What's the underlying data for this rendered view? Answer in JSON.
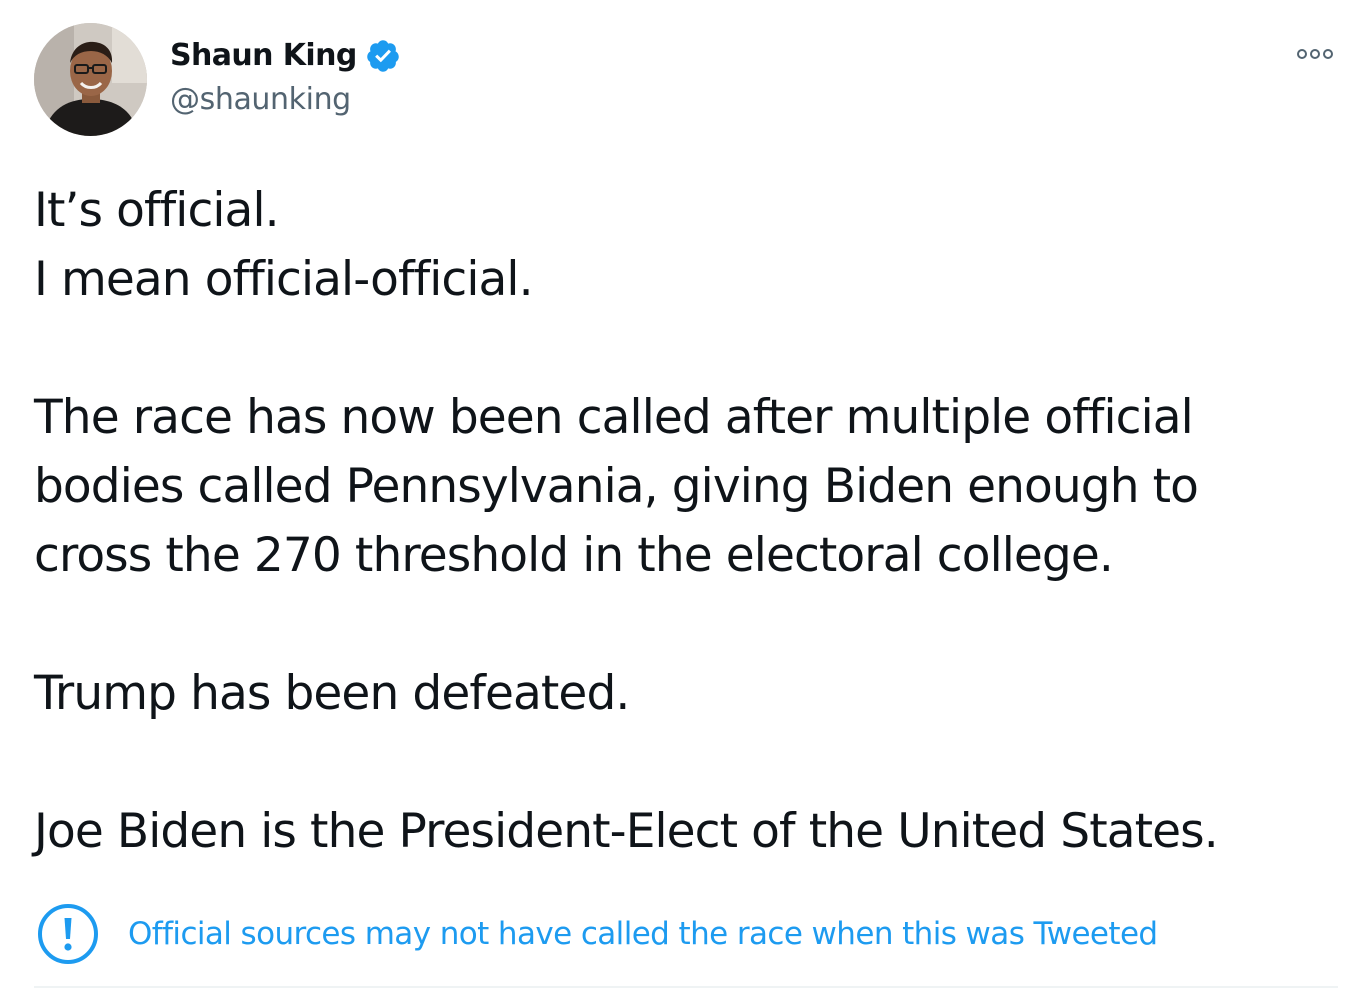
{
  "user": {
    "display_name": "Shaun King",
    "handle": "@shaunking",
    "verified_icon": "verified-badge-icon",
    "accent_color": "#1d9bf0"
  },
  "more_icon": "more-options-icon",
  "tweet": {
    "lines": [
      "It’s official.",
      "I mean official-official.",
      "",
      "The race has now been called after multiple official",
      "bodies called Pennsylvania, giving Biden enough to",
      "cross the 270 threshold in the electoral college.",
      "",
      "Trump has been defeated.",
      "",
      "Joe Biden is the President-Elect of the United States."
    ]
  },
  "notice": {
    "icon": "exclamation-circle-icon",
    "text": "Official sources may not have called the race when this was Tweeted",
    "color": "#1d9bf0"
  }
}
